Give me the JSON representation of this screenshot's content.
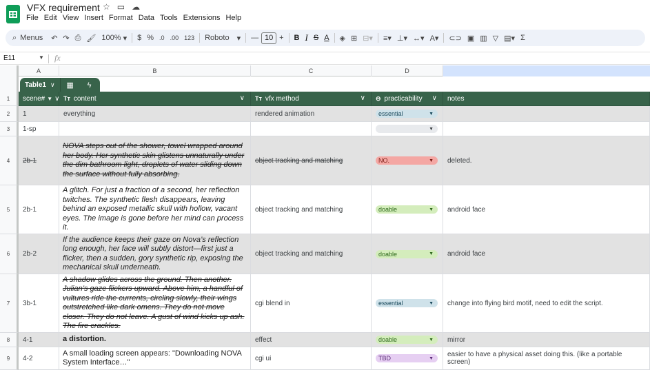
{
  "app": {
    "title": "VFX requirement",
    "menus": [
      "File",
      "Edit",
      "View",
      "Insert",
      "Format",
      "Data",
      "Tools",
      "Extensions",
      "Help"
    ]
  },
  "toolbar": {
    "menus_label": "Menus",
    "zoom": "100%",
    "currency": "$",
    "percent": "%",
    "dec_decrease": ".0",
    "dec_increase": ".00",
    "number_format": "123",
    "font": "Roboto",
    "font_size": "10",
    "bold": "B",
    "italic": "I",
    "strike": "S",
    "text_color": "A"
  },
  "formula_bar": {
    "cell_ref": "E11",
    "fx": "fx"
  },
  "columns": [
    "A",
    "B",
    "C",
    "D"
  ],
  "table": {
    "name": "Table1",
    "headers": {
      "scene": "scene#",
      "content": "content",
      "method": "vfx method",
      "practicability": "practicability",
      "notes": "notes"
    }
  },
  "row_numbers": [
    "1",
    "2",
    "3",
    "4",
    "5",
    "6",
    "7",
    "8",
    "9"
  ],
  "rows": [
    {
      "scene": "1",
      "content": "everything",
      "method": "rendered animation",
      "status": "essential",
      "notes": ""
    },
    {
      "scene": "1-sp",
      "content": "",
      "method": "",
      "status": "",
      "notes": ""
    },
    {
      "scene": "2b-1",
      "content": "NOVA steps out of the shower, towel wrapped around her body. Her synthetic skin glistens unnaturally under the dim bathroom light, droplets of water sliding down the surface without fully absorbing.",
      "method": "object tracking and matching",
      "status": "NO.",
      "notes": "deleted."
    },
    {
      "scene": "2b-1",
      "content": "A glitch. For just a fraction of a second, her reflection twitches. The synthetic flesh disappears, leaving behind an exposed metallic skull with hollow, vacant eyes. The image is gone before her mind can process it.",
      "method": "object tracking and matching",
      "status": "doable",
      "notes": "android face"
    },
    {
      "scene": "2b-2",
      "content": "If the audience keeps their gaze on Nova’s reflection long enough, her face will subtly distort—first just a flicker, then a sudden, gory synthetic rip, exposing the mechanical skull underneath.",
      "method": "object tracking and matching",
      "status": "doable",
      "notes": "android face"
    },
    {
      "scene": "3b-1",
      "content": "A shadow glides across the ground. Then another. Julian’s gaze flickers upward. Above him, a handful of vultures ride the currents, circling slowly, their wings outstretched like dark omens. They do not move closer. They do not leave. A gust of wind kicks up ash. The fire crackles.",
      "method": "cgi blend in",
      "status": "essential",
      "notes": "change into flying bird motif, need to edit the script."
    },
    {
      "scene": "4-1",
      "content": "a distortion.",
      "method": "effect",
      "status": "doable",
      "notes": "mirror"
    },
    {
      "scene": "4-2",
      "content": "A small loading screen appears: \"Downloading NOVA System Interface…\"",
      "method": "cgi ui",
      "status": "TBD",
      "notes": "easier to have a physical asset doing this. (like a portable screen)"
    }
  ],
  "status_colors": {
    "essential": "#cfe2ea",
    "doable": "#d4edbc",
    "NO.": "#f4a7a3",
    "TBD": "#e6cff2"
  },
  "header_color": "#38634a"
}
